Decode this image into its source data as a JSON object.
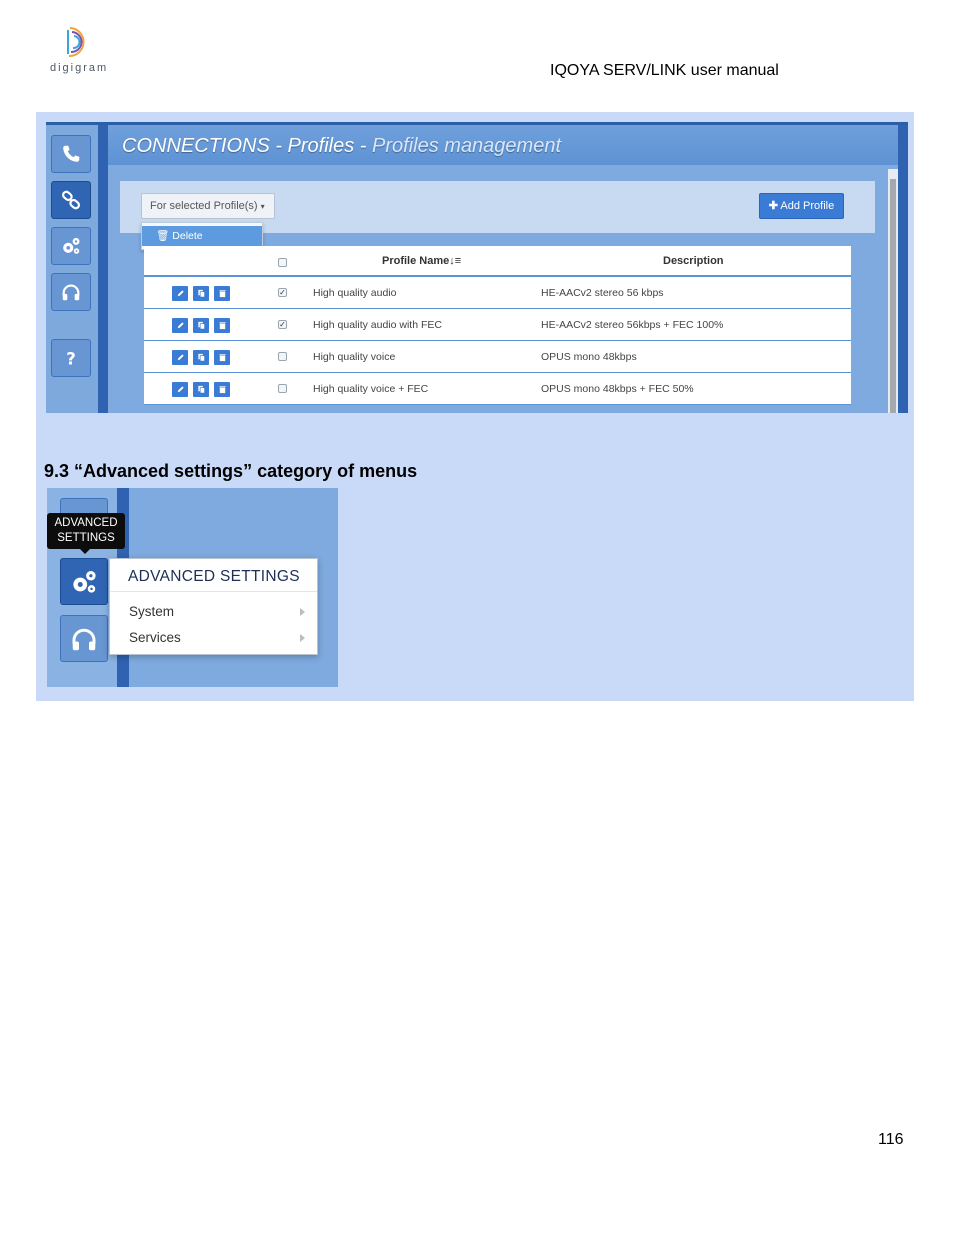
{
  "header": {
    "logo_text": "digigram",
    "doc_title": "IQOYA SERV/LINK user manual"
  },
  "profiles_screenshot": {
    "title_part1": "CONNECTIONS - Profiles - ",
    "title_part2": "Profiles management",
    "sidebar_icons": [
      "phone-icon",
      "link-icon",
      "gears-icon",
      "headphones-icon",
      "question-icon"
    ],
    "for_selected_label": "For selected Profile(s)",
    "add_profile_label": "Add Profile",
    "dropdown_item": "Delete",
    "columns": {
      "name": "Profile Name",
      "description": "Description"
    },
    "rows": [
      {
        "name": "High quality audio",
        "description": "HE-AACv2 stereo 56 kbps",
        "checked": true
      },
      {
        "name": "High quality audio with FEC",
        "description": "HE-AACv2 stereo 56kbps + FEC 100%",
        "checked": true
      },
      {
        "name": "High quality voice",
        "description": "OPUS mono 48kbps",
        "checked": false
      },
      {
        "name": "High quality voice + FEC",
        "description": "OPUS mono 48kbps + FEC 50%",
        "checked": false
      }
    ]
  },
  "section": {
    "title": "9.3 “Advanced settings” category of menus"
  },
  "advanced_screenshot": {
    "tooltip_line1": "ADVANCED",
    "tooltip_line2": "SETTINGS",
    "menu_title": "ADVANCED SETTINGS",
    "menu_items": [
      "System",
      "Services"
    ]
  },
  "footer": {
    "page_number": "116"
  },
  "colors": {
    "band": "#c9daf8",
    "accent_blue": "#3a7bd5",
    "dark_blue": "#2f62b0"
  }
}
